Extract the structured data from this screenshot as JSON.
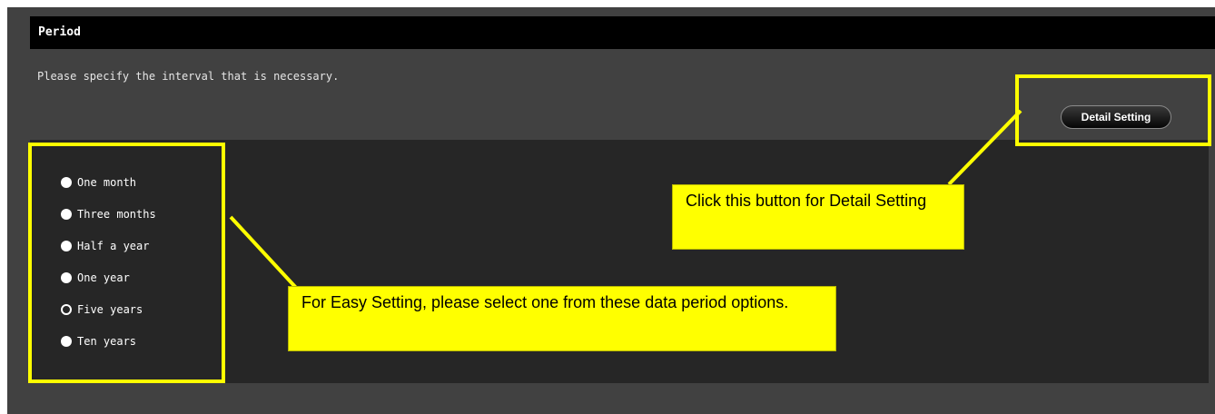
{
  "panel": {
    "title": "Period",
    "instruction": "Please specify the interval that is necessary."
  },
  "period_options": [
    {
      "label": "One month",
      "selected": false
    },
    {
      "label": "Three months",
      "selected": false
    },
    {
      "label": "Half a year",
      "selected": false
    },
    {
      "label": "One year",
      "selected": false
    },
    {
      "label": "Five years",
      "selected": true
    },
    {
      "label": "Ten years",
      "selected": false
    }
  ],
  "detail_button": {
    "label": "Detail Setting"
  },
  "callouts": {
    "detail": "Click this button for Detail Setting",
    "easy": "For Easy Setting, please select one from these data period options."
  },
  "colors": {
    "screen_background": "#414141",
    "options_background": "#262626",
    "title_bar": "#000000",
    "annotation": "#ffff00"
  }
}
